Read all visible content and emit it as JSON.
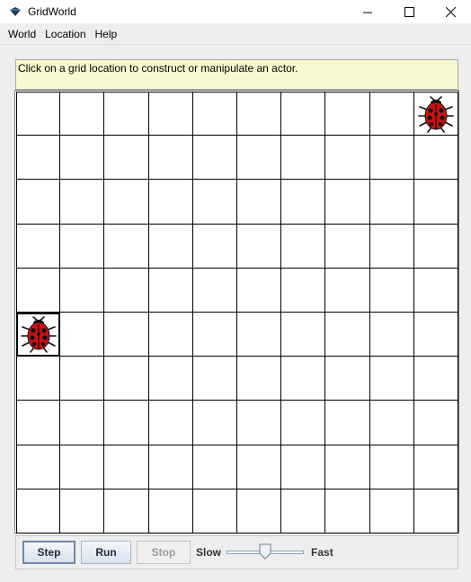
{
  "window": {
    "title": "GridWorld",
    "icon": "gridworld-app-icon",
    "controls": [
      "minimize-icon",
      "maximize-icon",
      "close-icon"
    ]
  },
  "menu": {
    "items": [
      "World",
      "Location",
      "Help"
    ]
  },
  "message": "Click on a grid location to construct or manipulate an actor.",
  "grid": {
    "rows": 10,
    "cols": 10,
    "selected_cell": {
      "row": 5,
      "col": 0
    },
    "actors": [
      {
        "type": "bug",
        "icon": "ladybug-icon",
        "row": 0,
        "col": 9,
        "color": "#d01010"
      },
      {
        "type": "bug",
        "icon": "ladybug-icon",
        "row": 5,
        "col": 0,
        "color": "#d01010"
      }
    ]
  },
  "controls": {
    "step_label": "Step",
    "run_label": "Run",
    "stop_label": "Stop",
    "stop_enabled": false,
    "slow_label": "Slow",
    "fast_label": "Fast",
    "speed_fraction": 0.5
  }
}
